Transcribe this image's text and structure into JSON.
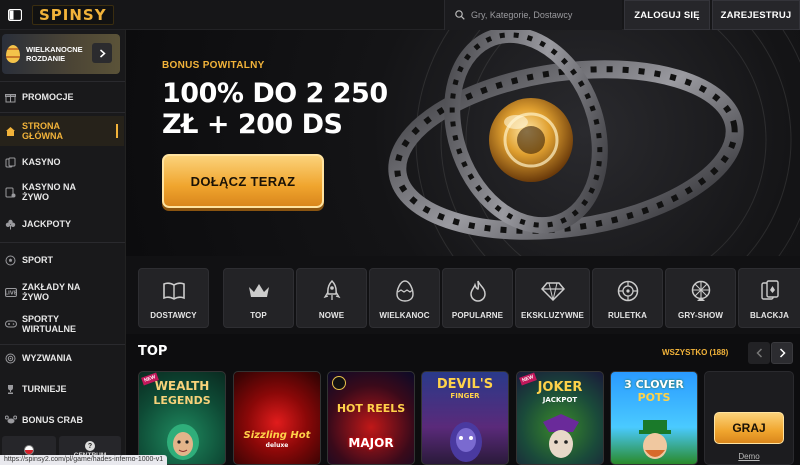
{
  "header": {
    "logo": "SPINSY",
    "search_placeholder": "Gry, Kategorie, Dostawcy",
    "login_label": "ZALOGUJ SIĘ",
    "register_label": "ZAREJESTRUJ"
  },
  "sidebar": {
    "promo_card": "WIELKANOCNE ROZDANIE",
    "items": [
      {
        "label": "PROMOCJE",
        "icon": "gift-icon"
      },
      {
        "label": "STRONA GŁÓWNA",
        "icon": "home-icon",
        "active": true
      },
      {
        "label": "KASYNO",
        "icon": "cards-icon"
      },
      {
        "label": "KASYNO NA ŻYWO",
        "icon": "live-cards-icon"
      },
      {
        "label": "JACKPOTY",
        "icon": "clover-icon"
      },
      {
        "label": "SPORT",
        "icon": "ball-icon"
      },
      {
        "label": "ZAKŁADY NA ŻYWO",
        "icon": "live-badge-icon"
      },
      {
        "label": "SPORTY WIRTUALNE",
        "icon": "gamepad-icon"
      },
      {
        "label": "WYZWANIA",
        "icon": "target-icon"
      },
      {
        "label": "TURNIEJE",
        "icon": "trophy-icon"
      },
      {
        "label": "BONUS CRAB",
        "icon": "crab-icon"
      }
    ],
    "help_label": "CENTRUM"
  },
  "hero": {
    "kicker": "BONUS POWITALNY",
    "headline_line1": "100% DO 2 250",
    "headline_line2": "ZŁ + 200 DS",
    "cta_label": "DOŁĄCZ TERAZ"
  },
  "categories": [
    {
      "label": "DOSTAWCY",
      "icon": "book-icon"
    },
    {
      "label": "TOP",
      "icon": "crown-icon"
    },
    {
      "label": "NOWE",
      "icon": "rocket-icon"
    },
    {
      "label": "WIELKANOC",
      "icon": "easter-egg-icon"
    },
    {
      "label": "POPULARNE",
      "icon": "flame-icon"
    },
    {
      "label": "EKSKLUZYWNE",
      "icon": "diamond-icon"
    },
    {
      "label": "RULETKA",
      "icon": "roulette-icon"
    },
    {
      "label": "GRY-SHOW",
      "icon": "wheel-icon"
    },
    {
      "label": "BLACKJA",
      "icon": "blackjack-icon"
    }
  ],
  "top_section": {
    "title": "TOP",
    "see_all": "WSZYSTKO (188)",
    "games": [
      {
        "title_line1": "WEALTH",
        "title_line2": "LEGENDS"
      },
      {
        "title_line1": "Sizzling Hot",
        "title_line2": "deluxe"
      },
      {
        "title_line1": "HOT REELS",
        "title_line2": "MAJOR"
      },
      {
        "title_line1": "DEVIL'S",
        "title_line2": "FINGER"
      },
      {
        "title_line1": "JOKER",
        "title_line2": "JACKPOT"
      },
      {
        "title_line1": "3 CLOVER",
        "title_line2": "POTS"
      }
    ],
    "play_label": "GRAJ",
    "demo_label": "Demo"
  },
  "status_url": "https://spinsy2.com/pl/game/hades-inferno-1000-v1",
  "colors": {
    "accent": "#f2b33a",
    "background": "#0d0d0f",
    "sidebar": "#19191b"
  }
}
